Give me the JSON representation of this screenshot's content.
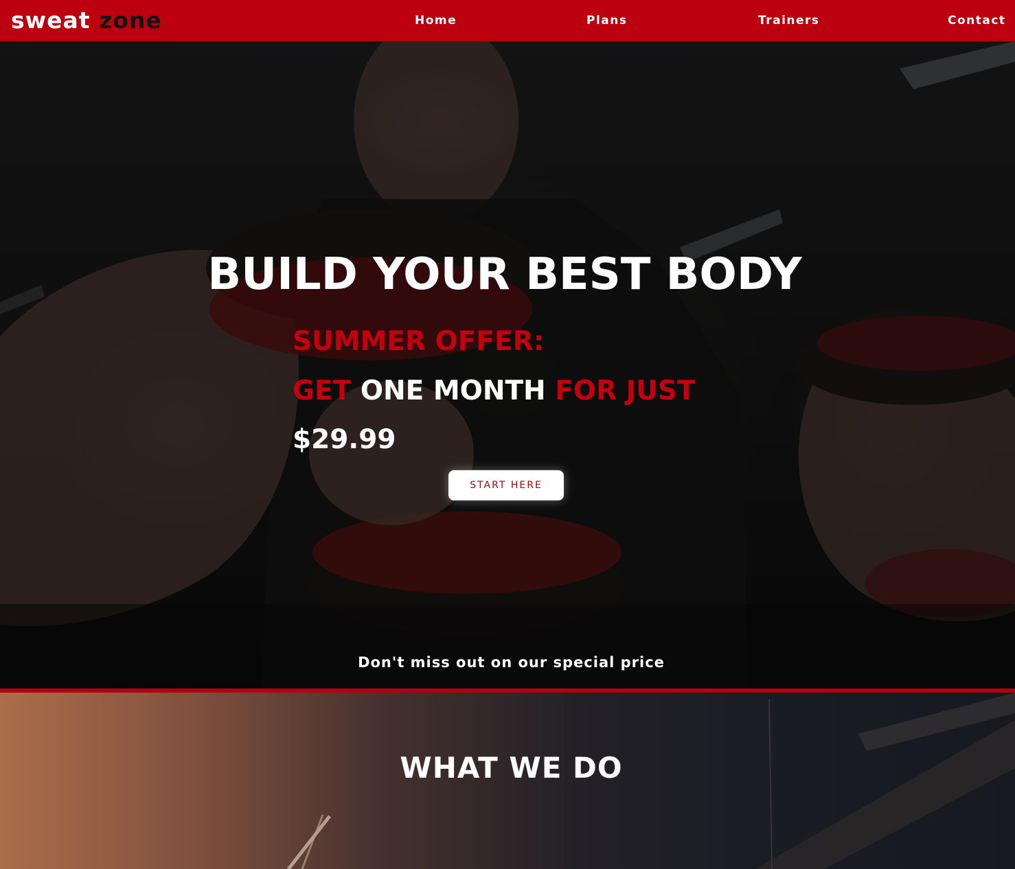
{
  "nav": {
    "logo_part1": "sweat",
    "logo_part2": "zone",
    "links": [
      "Home",
      "Plans",
      "Trainers",
      "Contact"
    ]
  },
  "hero": {
    "title": "BUILD YOUR BEST BODY",
    "offer_line1": "SUMMER OFFER:",
    "offer_line2_a": "GET",
    "offer_line2_b": "ONE MONTH",
    "offer_line2_c": "FOR JUST",
    "price": "$29.99",
    "cta_label": "START HERE",
    "tagline": "Don't miss out on our special price"
  },
  "section2": {
    "title": "WHAT WE DO"
  },
  "colors": {
    "brand_red": "#bd000f",
    "accent_red": "#c4000e",
    "text_white": "#ffffff",
    "logo_dark": "#141414"
  }
}
